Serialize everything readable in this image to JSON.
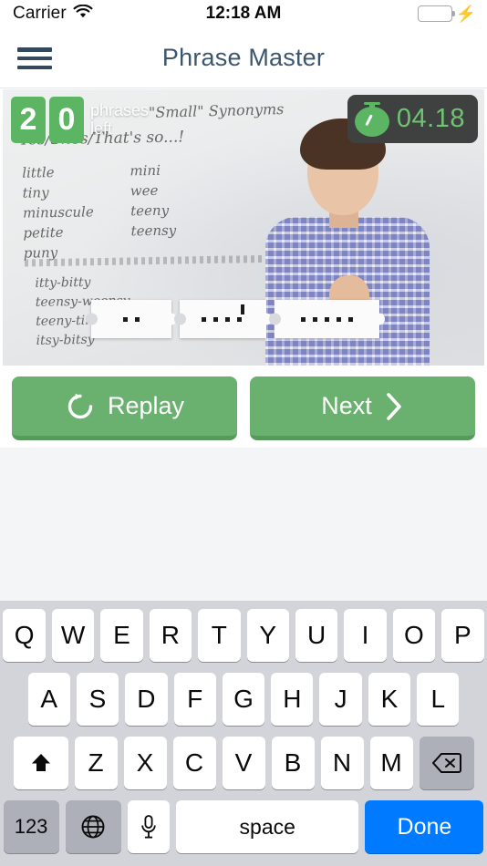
{
  "status_bar": {
    "carrier": "Carrier",
    "wifi_icon": "wifi-icon",
    "time": "12:18 AM",
    "battery_icon": "battery-full-icon",
    "charging_icon": "lightning-bolt-icon",
    "battery_color": "#3ad761"
  },
  "nav": {
    "menu_icon": "hamburger-menu-icon",
    "title": "Phrase Master",
    "title_color": "#3d566e"
  },
  "video": {
    "counter": {
      "digits": [
        "2",
        "0"
      ],
      "label": "phrases left",
      "badge_color": "#5cb563"
    },
    "timer": {
      "icon": "stopwatch-icon",
      "value": "04.18",
      "text_color": "#6ec472",
      "background_color": "#3f4140"
    },
    "whiteboard": {
      "title": "\"Small\"   Synonyms",
      "subtitle": "Yes/Shes/That's  so...!",
      "column_1": "little\ntiny\nminuscule\npetite\npuny",
      "column_2": "mini\nwee\nteeny\nteensy",
      "column_3": "itty-bitty\nteensy-weensy\nteeny-tiny\nitsy-bitsy"
    },
    "cards": [
      {
        "name": "phrase-card-1",
        "dots": 2,
        "apostrophe_after": null
      },
      {
        "name": "phrase-card-2",
        "dots": 4,
        "apostrophe_after": 3
      },
      {
        "name": "phrase-card-3",
        "dots": 5,
        "apostrophe_after": null
      }
    ]
  },
  "actions": {
    "replay_label": "Replay",
    "replay_icon": "replay-circular-arrow-icon",
    "next_label": "Next",
    "next_icon": "chevron-right-icon",
    "button_color": "#6ab06f",
    "button_shadow_color": "#579a5c"
  },
  "keyboard": {
    "row_1": [
      "Q",
      "W",
      "E",
      "R",
      "T",
      "Y",
      "U",
      "I",
      "O",
      "P"
    ],
    "row_2": [
      "A",
      "S",
      "D",
      "F",
      "G",
      "H",
      "J",
      "K",
      "L"
    ],
    "row_3": [
      "Z",
      "X",
      "C",
      "V",
      "B",
      "N",
      "M"
    ],
    "shift_icon": "shift-arrow-up-icon",
    "backspace_icon": "backspace-delete-icon",
    "numbers_label": "123",
    "globe_icon": "globe-language-icon",
    "mic_icon": "microphone-icon",
    "space_label": "space",
    "done_label": "Done",
    "done_color": "#007aff",
    "background_color": "#d2d4da"
  }
}
